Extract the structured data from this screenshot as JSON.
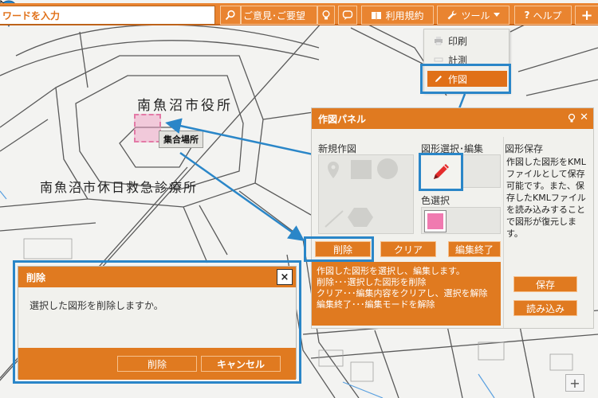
{
  "toolbar": {
    "search_placeholder": "ワードを入力",
    "feedback_label": "ご意見･ご要望",
    "terms_label": "利用規約",
    "tools_label": "ツール",
    "help_label": "ヘルプ",
    "add_label": "+"
  },
  "tools_menu": {
    "items": [
      {
        "label": "印刷",
        "icon": "printer-icon"
      },
      {
        "label": "計測",
        "icon": "ruler-icon"
      },
      {
        "label": "作図",
        "icon": "pencil-icon"
      }
    ]
  },
  "map": {
    "label_cityhall": "南魚沼市役所",
    "label_clinic": "南魚沼市休日救急診療所",
    "marker_tag": "集合場所",
    "selection_color": "#f07ab0"
  },
  "draw_panel": {
    "title": "作図パネル",
    "section_new": "新規作図",
    "section_select": "図形選択･編集",
    "section_save": "図形保存",
    "section_color": "色選択",
    "save_description": "作図した図形をKMLファイルとして保存可能です。また、保存したKMLファイルを読み込みすることで図形が復元します。",
    "save_button": "保存",
    "load_button": "読み込み",
    "delete_button": "削除",
    "clear_button": "クリア",
    "finish_button": "編集終了",
    "help_lines": [
      "作図した図形を選択し、編集します。",
      "削除･･･選択した図形を削除",
      "クリア･･･編集内容をクリアし、選択を解除",
      "編集終了･･･編集モードを解除"
    ]
  },
  "dialog": {
    "title": "削除",
    "message": "選択した図形を削除しますか。",
    "confirm_button": "削除",
    "cancel_button": "キャンセル",
    "close_label": "×"
  },
  "zoom": {
    "in_label": "+"
  },
  "colors": {
    "accent": "#e07a20",
    "toolbar": "#e98430",
    "callout": "#2a86c8"
  }
}
